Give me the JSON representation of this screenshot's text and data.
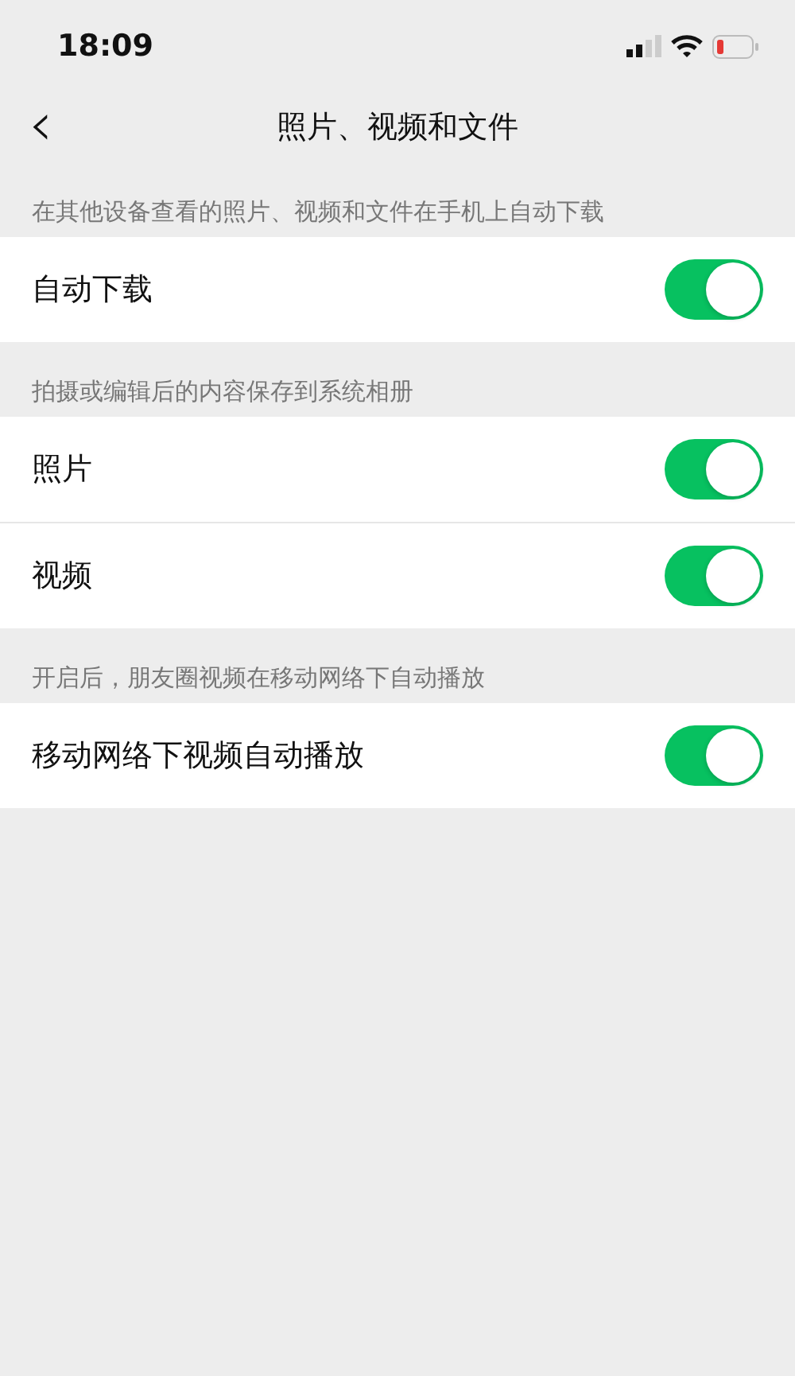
{
  "status_bar": {
    "time": "18:09"
  },
  "nav": {
    "back": "‹",
    "title": "照片、视频和文件"
  },
  "sections": [
    {
      "header": "在其他设备查看的照片、视频和文件在手机上自动下载",
      "rows": [
        {
          "label": "自动下载",
          "on": true
        }
      ]
    },
    {
      "header": "拍摄或编辑后的内容保存到系统相册",
      "rows": [
        {
          "label": "照片",
          "on": true
        },
        {
          "label": "视频",
          "on": true
        }
      ]
    },
    {
      "header": "开启后，朋友圈视频在移动网络下自动播放",
      "rows": [
        {
          "label": "移动网络下视频自动播放",
          "on": true
        }
      ]
    }
  ]
}
